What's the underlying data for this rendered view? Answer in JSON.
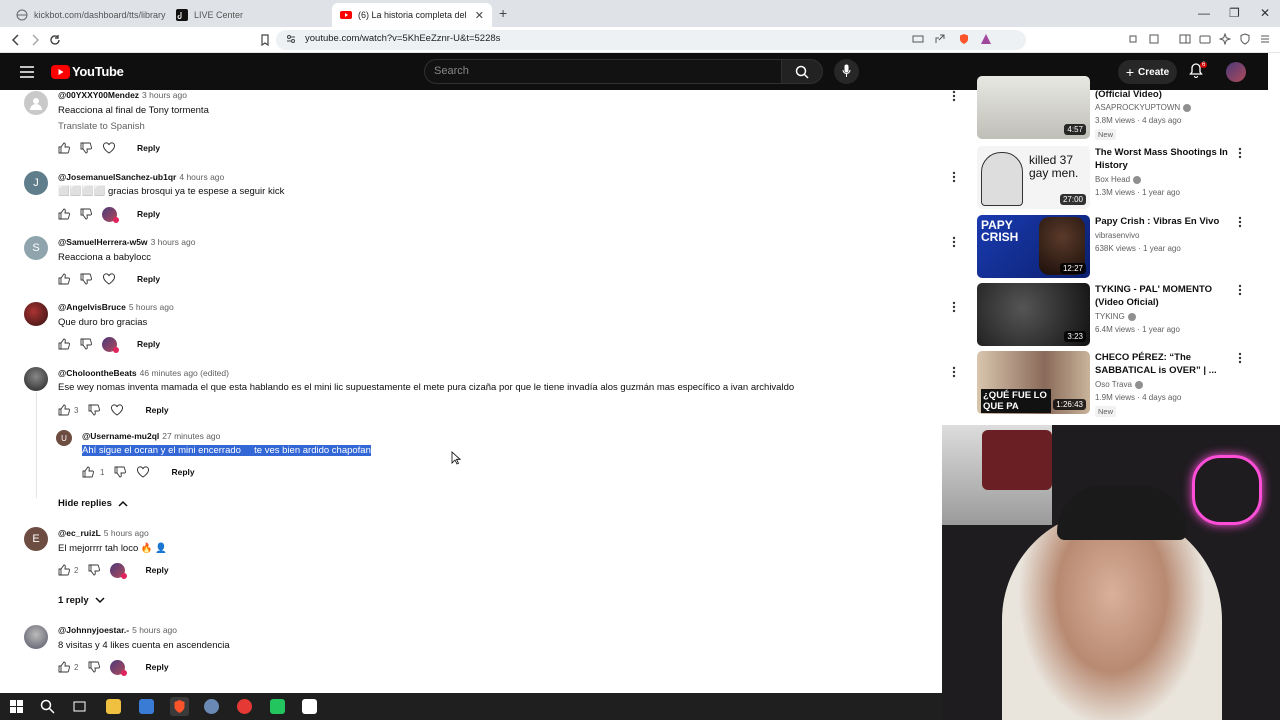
{
  "browser": {
    "tabs": [
      {
        "title": "kickbot.com/dashboard/tts/library"
      },
      {
        "title": "LIVE Center"
      },
      {
        "title": "(6) La historia completa del NIN"
      }
    ],
    "url": "youtube.com/watch?v=5KhEeZznr-U&t=5228s"
  },
  "youtube": {
    "logo": "YouTube",
    "search_placeholder": "Search",
    "create_label": "Create",
    "notifications_count": "6"
  },
  "comments": [
    {
      "handle": "@00YXXY00Mendez",
      "time": "3 hours ago",
      "text": "Reacciona al final de Tony tormenta",
      "translate": "Translate to Spanish",
      "likes": "",
      "reply": "Reply"
    },
    {
      "handle": "@JosemanuelSanchez-ub1qr",
      "time": "4 hours ago",
      "avatar_letter": "J",
      "text": "⬜⬜⬜⬜ gracias brosqui ya te espese a seguir kick",
      "likes": "",
      "reply": "Reply"
    },
    {
      "handle": "@SamuelHerrera-w5w",
      "time": "3 hours ago",
      "avatar_letter": "S",
      "text": "Reacciona a babylocc",
      "likes": "",
      "reply": "Reply"
    },
    {
      "handle": "@AngelvisBruce",
      "time": "5 hours ago",
      "text": "Que duro bro gracias",
      "likes": "",
      "reply": "Reply"
    },
    {
      "handle": "@CholoontheBeats",
      "time": "46 minutes ago (edited)",
      "text": "Ese wey nomas inventa mamada el que esta hablando es el mini lic supuestamente el mete pura cizaña por que le tiene invadía alos guzmán mas específico a ivan archivaldo",
      "likes": "3",
      "reply": "Reply"
    },
    {
      "handle": "@ec_ruizL",
      "time": "5 hours ago",
      "avatar_letter": "E",
      "text": "El mejorrrr tah loco 🔥 👤",
      "likes": "2",
      "reply": "Reply"
    },
    {
      "handle": "@Johnnyjoestar.-",
      "time": "5 hours ago",
      "text": "8 visitas y 4 likes cuenta en ascendencia",
      "likes": "2",
      "reply": "Reply"
    }
  ],
  "reply": {
    "handle": "@Username-mu2ql",
    "time": "27 minutes ago",
    "avatar_letter": "U",
    "text_a": "Ahí sigue el ocran y el mini encerrado",
    "text_b": "te ves bien ardido chapofan",
    "likes": "1",
    "reply": "Reply"
  },
  "hide_replies": "Hide replies",
  "one_reply": "1 reply",
  "recommendations": [
    {
      "title": "(Official Video)",
      "channel": "ASAPROCKYUPTOWN",
      "views": "3.8M views · 4 days ago",
      "duration": "4:57",
      "new": "New",
      "thumb_color": "#d8d8d2"
    },
    {
      "title": "The Worst Mass Shootings In History",
      "channel": "Box Head",
      "views": "1.3M views · 1 year ago",
      "duration": "27:00",
      "thumb_text": "killed 37 gay men.",
      "thumb_color": "#f2f2f2"
    },
    {
      "title": "Papy Crish : Vibras En Vivo",
      "channel": "vibrasenvivo",
      "views": "638K views · 1 year ago",
      "duration": "12:27",
      "thumb_text": "PAPY CRISH",
      "thumb_color": "#1d3ea8"
    },
    {
      "title": "TYKING - PAL' MOMENTO (Video Oficial)",
      "channel": "TYKING",
      "views": "6.4M views · 1 year ago",
      "duration": "3:23",
      "thumb_color": "#2a2a2a"
    },
    {
      "title": "CHECO PÉREZ: “The SABBATICAL is OVER” | ...",
      "channel": "Oso Trava",
      "views": "1.9M views · 4 days ago",
      "duration": "1:26:43",
      "new": "New",
      "thumb_text": "¿QUÉ FUE LO QUE PA",
      "thumb_color": "#c7b39a"
    }
  ]
}
